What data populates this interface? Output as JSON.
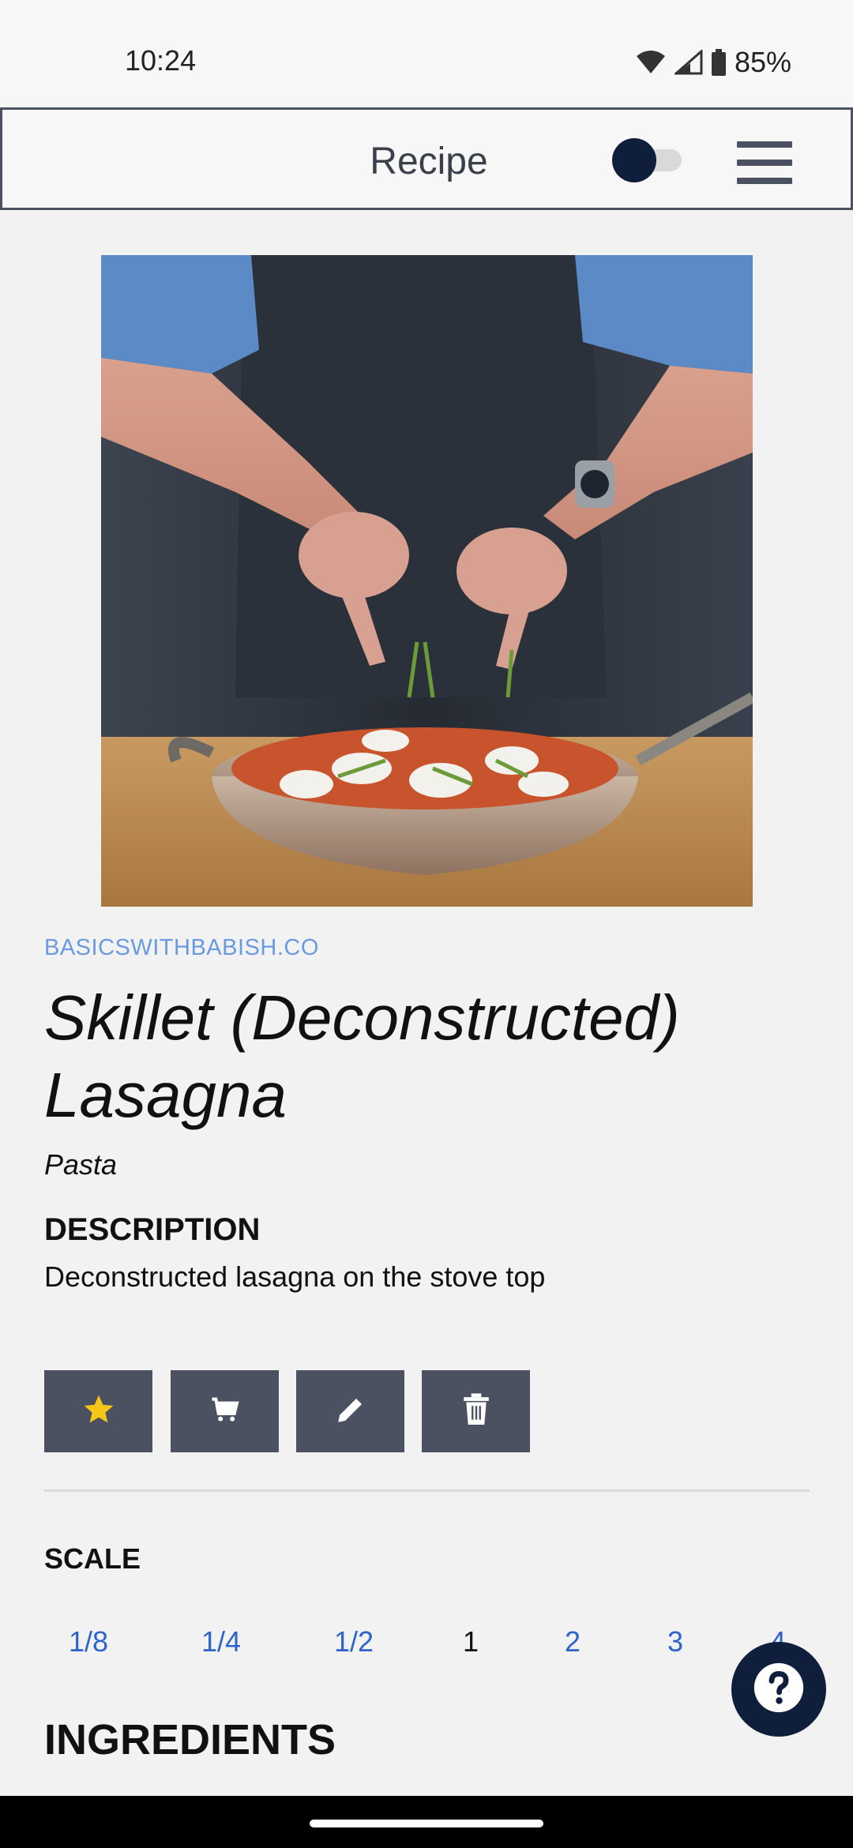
{
  "status_bar": {
    "time": "10:24",
    "battery": "85%"
  },
  "header": {
    "title": "Recipe"
  },
  "recipe": {
    "source": "BASICSWITHBABISH.CO",
    "title": "Skillet (Deconstructed) Lasagna",
    "category": "Pasta",
    "description_heading": "DESCRIPTION",
    "description": "Deconstructed lasagna on the stove top"
  },
  "actions": [
    {
      "icon": "star-icon",
      "color": "#f5c518"
    },
    {
      "icon": "cart-icon"
    },
    {
      "icon": "pencil-icon"
    },
    {
      "icon": "trash-icon"
    }
  ],
  "scale": {
    "heading": "SCALE",
    "options": [
      "1/8",
      "1/4",
      "1/2",
      "1",
      "2",
      "3",
      "4"
    ],
    "selected": "1"
  },
  "ingredients_heading": "INGREDIENTS",
  "colors": {
    "accent_dark": "#0f1e3a",
    "button_gray": "#4b5160",
    "link_blue": "#2e63c9",
    "source_blue": "#6a9ae0"
  }
}
